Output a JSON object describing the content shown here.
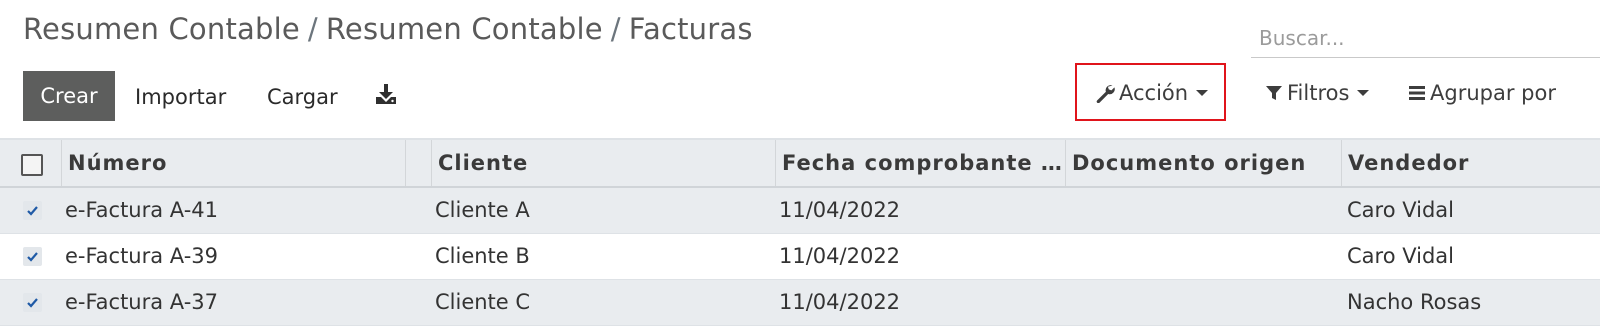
{
  "breadcrumb": {
    "items": [
      "Resumen Contable",
      "Resumen Contable",
      "Facturas"
    ],
    "separator": "/"
  },
  "search": {
    "placeholder": "Buscar..."
  },
  "toolbar": {
    "create_label": "Crear",
    "import_label": "Importar",
    "load_label": "Cargar",
    "download_icon": "download-icon",
    "action_label": "Acción",
    "filters_label": "Filtros",
    "group_by_label": "Agrupar por"
  },
  "table": {
    "columns": [
      "Número",
      "Cliente",
      "Fecha comprobante …",
      "Documento origen",
      "Vendedor"
    ],
    "rows": [
      {
        "numero": "e-Factura A-41",
        "cliente": "Cliente A",
        "fecha": "11/04/2022",
        "documento": "",
        "vendedor": "Caro Vidal",
        "checked": true
      },
      {
        "numero": "e-Factura A-39",
        "cliente": "Cliente B",
        "fecha": "11/04/2022",
        "documento": "",
        "vendedor": "Caro Vidal",
        "checked": true
      },
      {
        "numero": "e-Factura A-37",
        "cliente": "Cliente C",
        "fecha": "11/04/2022",
        "documento": "",
        "vendedor": "Nacho Rosas",
        "checked": true
      }
    ]
  },
  "colors": {
    "primary_button": "#5d5e5d",
    "highlight_border": "#e0141b",
    "header_bg": "#e9ecef",
    "check_color": "#1f5aa6"
  }
}
